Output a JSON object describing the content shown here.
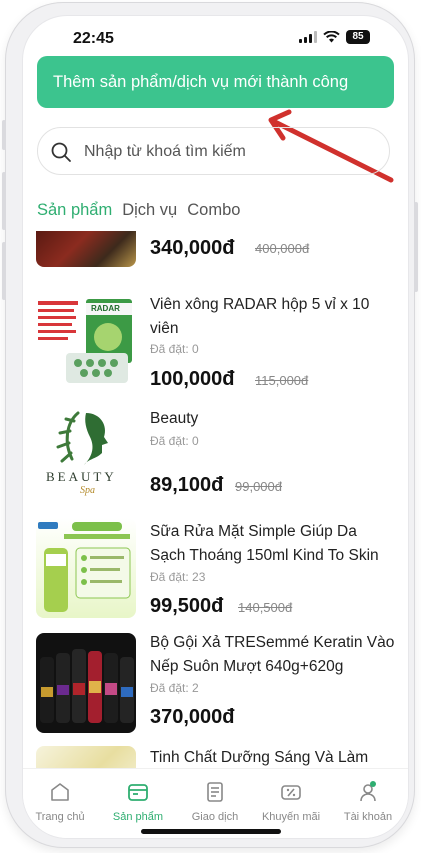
{
  "status_bar": {
    "time": "22:45",
    "battery": "85"
  },
  "toast": {
    "message": "Thêm sản phẩm/dịch vụ mới thành công",
    "color": "#3cc48e"
  },
  "search": {
    "placeholder": "Nhập từ khoá tìm kiếm"
  },
  "tabs": [
    {
      "label": "Sản phẩm",
      "active": true
    },
    {
      "label": "Dịch vụ",
      "active": false
    },
    {
      "label": "Combo",
      "active": false
    }
  ],
  "products": [
    {
      "title": "",
      "sold": "",
      "price": "340,000đ",
      "old_price": "400,000đ"
    },
    {
      "title": "Viên xông RADAR hộp 5 vỉ x 10 viên",
      "sold": "Đã đặt: 0",
      "price": "100,000đ",
      "old_price": "115,000đ"
    },
    {
      "title": "Beauty",
      "sold": "Đã đặt: 0",
      "price": "89,100đ",
      "old_price": "99,000đ"
    },
    {
      "title": "Sữa Rửa Mặt Simple Giúp Da Sạch Thoáng 150ml Kind To Skin",
      "sold": "Đã đặt: 23",
      "price": "99,500đ",
      "old_price": "140,500đ"
    },
    {
      "title": "Bộ Gội Xả TRESemmé Keratin Vào Nếp Suôn Mượt 640g+620g",
      "sold": "Đã đặt: 2",
      "price": "370,000đ",
      "old_price": ""
    },
    {
      "title": "Tinh Chất Dưỡng Sáng Và Làm",
      "sold": "",
      "price": "",
      "old_price": ""
    }
  ],
  "thumb_text": {
    "beauty_logo": "BEAUTY",
    "beauty_sub": "Spa",
    "radar_box": "RADAR"
  },
  "bottom_nav": [
    {
      "label": "Trang chủ",
      "icon": "home-icon",
      "active": false
    },
    {
      "label": "Sản phẩm",
      "icon": "product-icon",
      "active": true
    },
    {
      "label": "Giao dịch",
      "icon": "receipt-icon",
      "active": false
    },
    {
      "label": "Khuyến mãi",
      "icon": "discount-icon",
      "active": false
    },
    {
      "label": "Tài khoản",
      "icon": "account-icon",
      "active": false
    }
  ],
  "colors": {
    "accent": "#2fae71",
    "arrow": "#d0312d",
    "notify_dot": "#2fae71"
  }
}
